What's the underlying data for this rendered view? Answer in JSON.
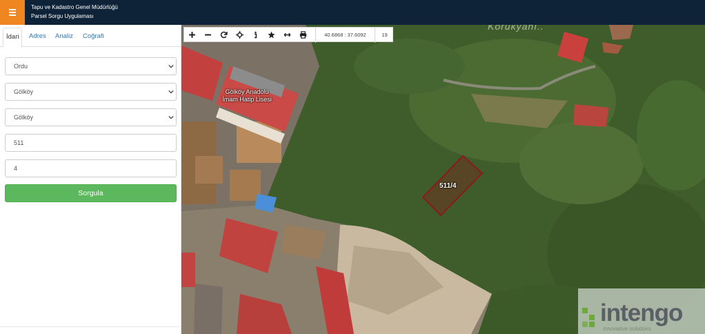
{
  "header": {
    "menu_icon": "hamburger-icon",
    "title_line1": "Tapu ve Kadastro Genel Müdürlüğü",
    "title_line2": "Parsel Sorgu Uygulaması",
    "brand_color": "#0e2238",
    "accent_color": "#f0861f"
  },
  "sidebar": {
    "tabs": [
      {
        "label": "İdari",
        "active": true
      },
      {
        "label": "Adres",
        "active": false
      },
      {
        "label": "Analiz",
        "active": false
      },
      {
        "label": "Coğrafi",
        "active": false
      }
    ],
    "form": {
      "province": "Ordu",
      "district": "Gölköy",
      "neighborhood": "Gölköy",
      "block": "511",
      "parcel": "4"
    },
    "submit_label": "Sorgula",
    "submit_color": "#5cb85c"
  },
  "map": {
    "toolbar": {
      "tools": [
        "zoom-in-icon",
        "zoom-out-icon",
        "refresh-icon",
        "locate-icon",
        "info-icon",
        "star-icon",
        "measure-icon",
        "print-icon"
      ],
      "coordinates": "40.6868 : 37.6092",
      "zoom_level": "19"
    },
    "labels": {
      "school_line1": "Gölköy Anadolu",
      "school_line2": "İmam Hatip Lisesi",
      "parcel": "511/4",
      "top_text": "Korukyanı.."
    },
    "parcel_color": "#8b1a1a",
    "watermark": {
      "word": "intengo",
      "tagline": "innovative solutions"
    }
  }
}
